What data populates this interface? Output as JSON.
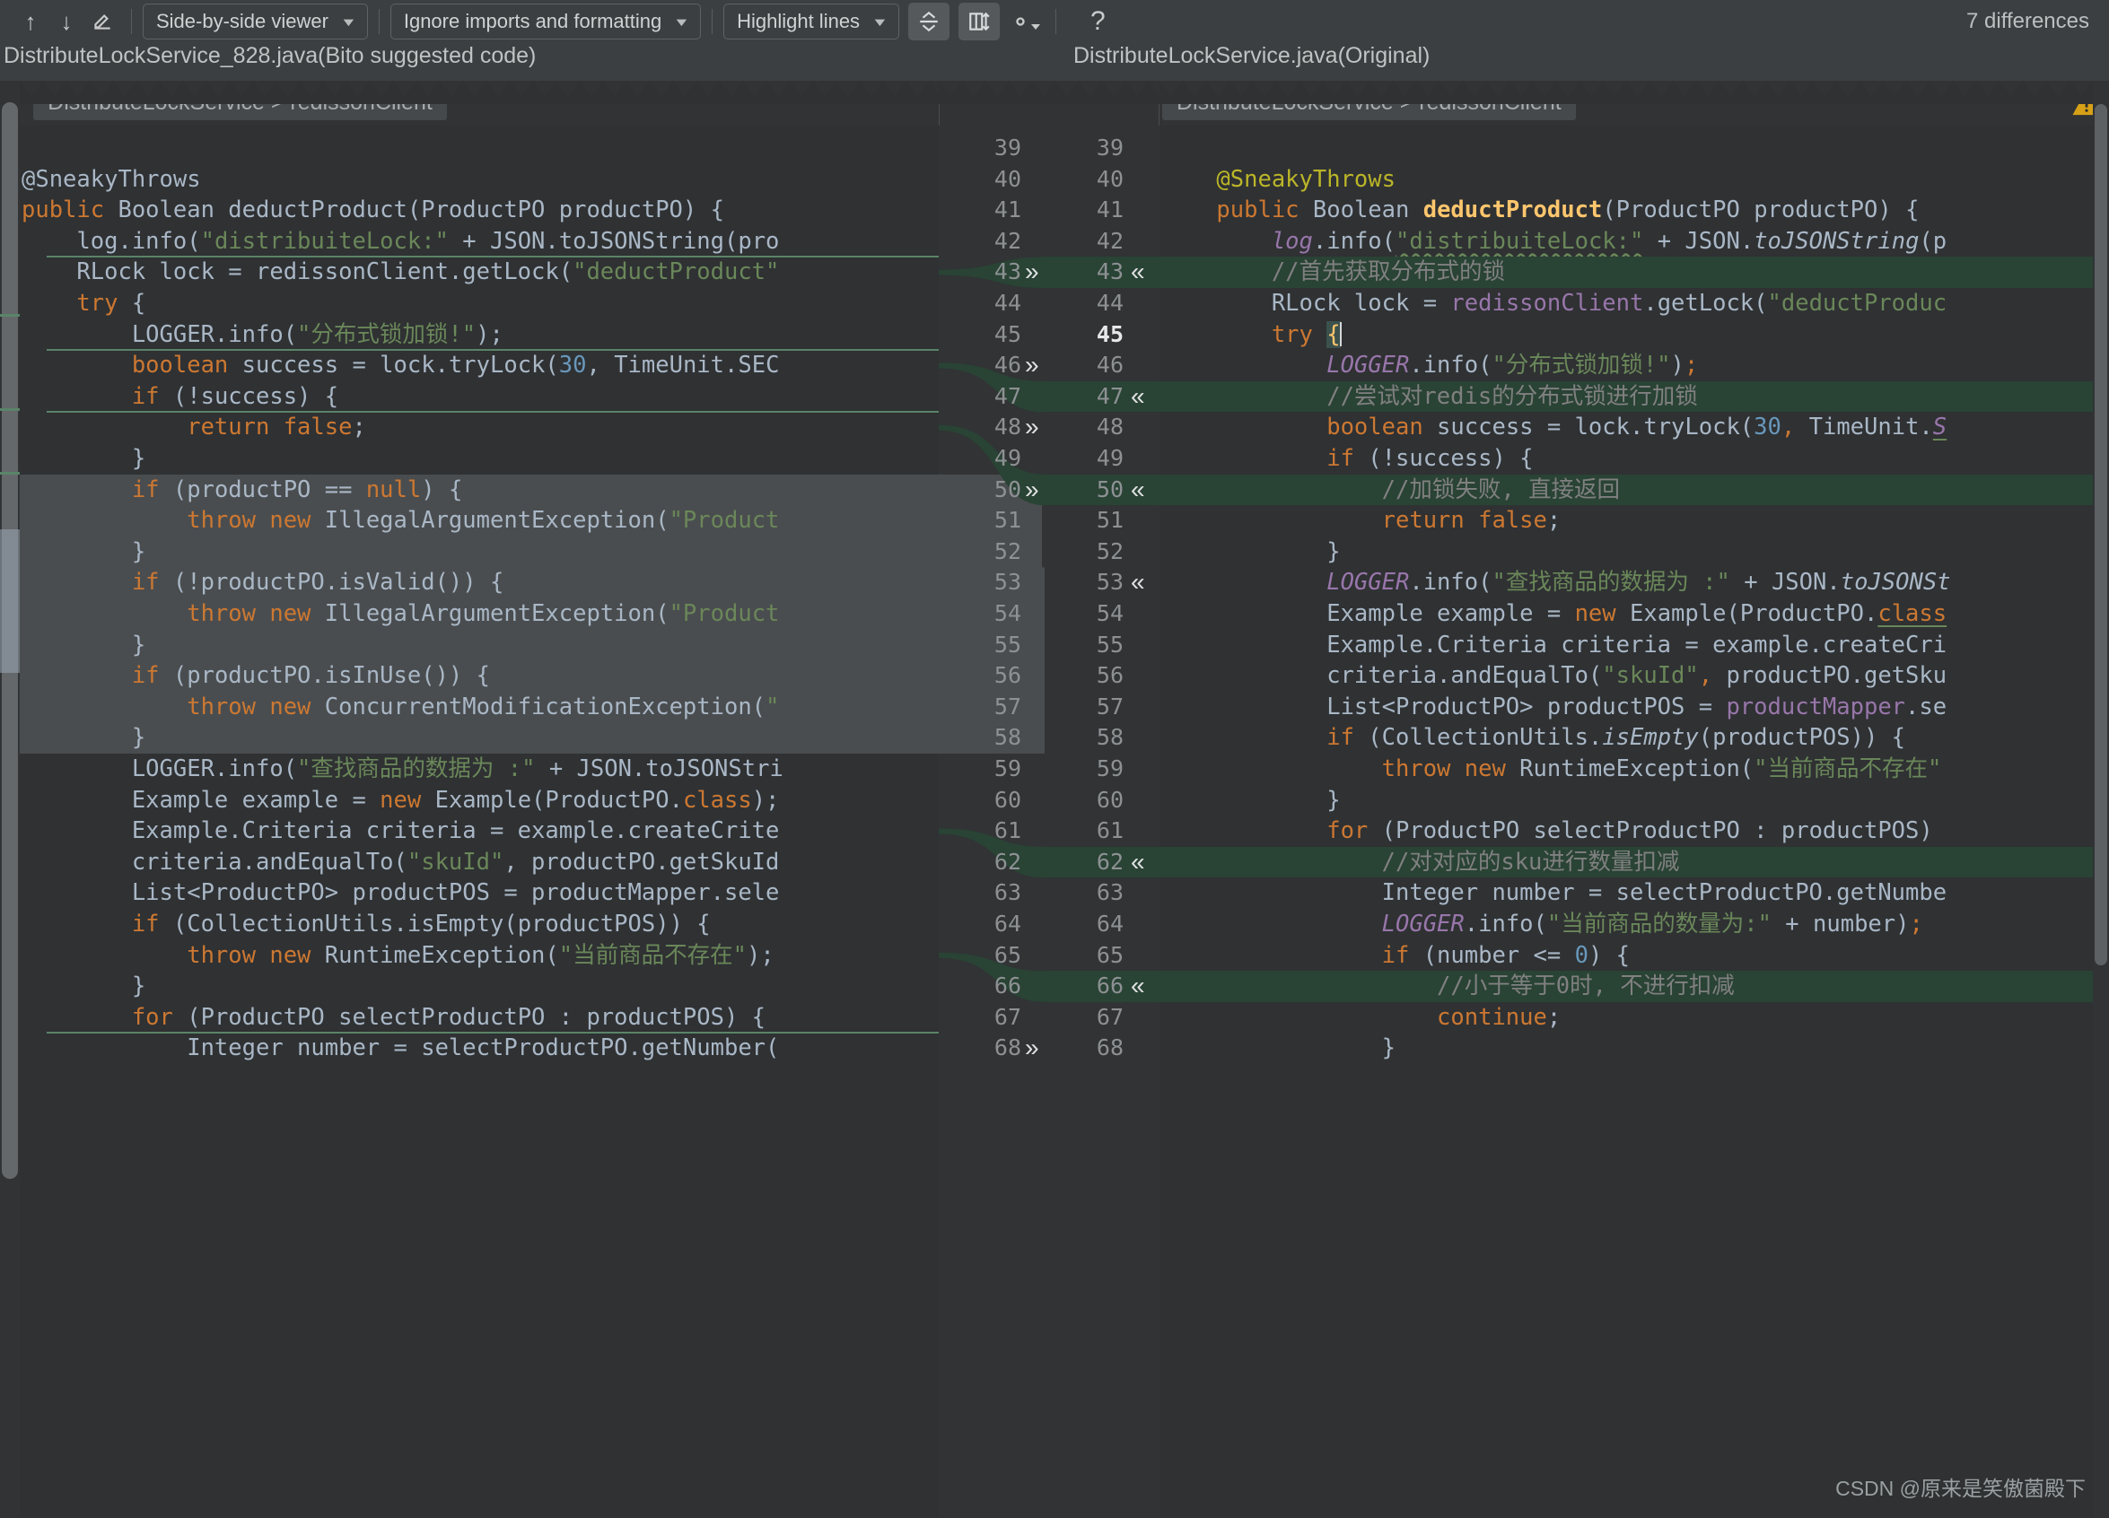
{
  "toolbar": {
    "prev_icon": "arrow-up-icon",
    "next_icon": "arrow-down-icon",
    "edit_icon": "pencil-icon",
    "viewer_mode": "Side-by-side viewer",
    "ignore_policy": "Ignore imports and formatting",
    "highlight_mode": "Highlight lines",
    "collapse_icon": "collapse-unchanged-icon",
    "whitespace_icon": "columns-sync-icon",
    "settings_icon": "gear-icon",
    "help_icon": "question-mark-icon",
    "difference_count": "7 differences",
    "caret": "▼"
  },
  "left_pane": {
    "file_title": "DistributeLockService_828.java(Bito suggested code)",
    "status_icon": "green-check-icon",
    "breadcrumb": "DistributeLockService > redissonClient"
  },
  "right_pane": {
    "file_title": "DistributeLockService.java(Original)",
    "breadcrumb": "DistributeLockService > redissonClient",
    "warning_icon": "warning-triangle-icon"
  },
  "colors": {
    "editor_bg": "#2f3133",
    "chrome_bg": "#3c3f41",
    "gutter_bg": "#313335",
    "diff_added_bg": "#294335",
    "diff_changed_bg": "#4a4d4f",
    "keyword": "#cc7832",
    "string": "#6a8759",
    "number": "#6897bb",
    "text": "#a9b7c6",
    "comment": "#808080",
    "field": "#9876aa",
    "method": "#ffc66d",
    "annotation": "#bbb529",
    "ok_green": "#499c54",
    "warn_yellow": "#d6a117"
  },
  "line_numbers": {
    "left": [
      39,
      40,
      41,
      42,
      43,
      44,
      45,
      46,
      47,
      48,
      49,
      50,
      51,
      52,
      53,
      54,
      55,
      56,
      57,
      58,
      59,
      60,
      61,
      62,
      63,
      64,
      65,
      66,
      67,
      68
    ],
    "right": [
      39,
      40,
      41,
      42,
      43,
      44,
      45,
      46,
      47,
      48,
      49,
      50,
      51,
      52,
      53,
      54,
      55,
      56,
      57,
      58,
      59,
      60,
      61,
      62,
      63,
      64,
      65,
      66,
      67,
      68
    ],
    "current_line": 45,
    "left_chevrons": [
      43,
      46,
      48,
      50,
      68
    ],
    "right_chevrons": [
      43,
      47,
      50,
      53,
      62,
      66
    ]
  },
  "left_code": [
    {
      "n": 39,
      "diff": "none",
      "tokens": []
    },
    {
      "n": 40,
      "diff": "none",
      "tokens": [
        {
          "t": "@SneakyThrows",
          "c": "txt"
        }
      ]
    },
    {
      "n": 41,
      "diff": "none",
      "tokens": [
        {
          "t": "public ",
          "c": "kw"
        },
        {
          "t": "Boolean deductProduct(ProductPO productPO) {",
          "c": "txt"
        }
      ]
    },
    {
      "n": 42,
      "diff": "none",
      "tokens": [
        {
          "t": "    log.info(",
          "c": "txt"
        },
        {
          "t": "\"distribuiteLock:\"",
          "c": "str"
        },
        {
          "t": " + JSON.toJSONString(pro",
          "c": "txt"
        }
      ]
    },
    {
      "n": 43,
      "diff": "delmark",
      "tokens": [
        {
          "t": "    RLock lock = redissonClient.getLock(",
          "c": "txt"
        },
        {
          "t": "\"deductProduct\"",
          "c": "str"
        }
      ]
    },
    {
      "n": 44,
      "diff": "none",
      "tokens": [
        {
          "t": "    try",
          "c": "kw"
        },
        {
          "t": " {",
          "c": "txt"
        }
      ]
    },
    {
      "n": 45,
      "diff": "none",
      "tokens": [
        {
          "t": "        LOGGER.info(",
          "c": "txt"
        },
        {
          "t": "\"分布式锁加锁!\"",
          "c": "str"
        },
        {
          "t": ");",
          "c": "txt"
        }
      ]
    },
    {
      "n": 46,
      "diff": "delmark",
      "tokens": [
        {
          "t": "        boolean",
          "c": "kw"
        },
        {
          "t": " success = lock.tryLock(",
          "c": "txt"
        },
        {
          "t": "30",
          "c": "num"
        },
        {
          "t": ", TimeUnit.SEC",
          "c": "txt"
        }
      ]
    },
    {
      "n": 47,
      "diff": "none",
      "tokens": [
        {
          "t": "        if",
          "c": "kw"
        },
        {
          "t": " (!success) {",
          "c": "txt"
        }
      ]
    },
    {
      "n": 48,
      "diff": "delmark",
      "tokens": [
        {
          "t": "            return false",
          "c": "kw"
        },
        {
          "t": ";",
          "c": "txt"
        }
      ]
    },
    {
      "n": 49,
      "diff": "none",
      "tokens": [
        {
          "t": "        }",
          "c": "txt"
        }
      ]
    },
    {
      "n": 50,
      "diff": "gray",
      "tokens": [
        {
          "t": "        if",
          "c": "kw"
        },
        {
          "t": " (productPO == ",
          "c": "txt"
        },
        {
          "t": "null",
          "c": "kw"
        },
        {
          "t": ") {",
          "c": "txt"
        }
      ]
    },
    {
      "n": 51,
      "diff": "gray",
      "tokens": [
        {
          "t": "            throw new",
          "c": "kw"
        },
        {
          "t": " IllegalArgumentException(",
          "c": "txt"
        },
        {
          "t": "\"Product",
          "c": "str"
        }
      ]
    },
    {
      "n": 52,
      "diff": "gray",
      "tokens": [
        {
          "t": "        }",
          "c": "txt"
        }
      ]
    },
    {
      "n": 53,
      "diff": "gray",
      "tokens": [
        {
          "t": "        if",
          "c": "kw"
        },
        {
          "t": " (!productPO.isValid()) {",
          "c": "txt"
        }
      ]
    },
    {
      "n": 54,
      "diff": "gray",
      "tokens": [
        {
          "t": "            throw new",
          "c": "kw"
        },
        {
          "t": " IllegalArgumentException(",
          "c": "txt"
        },
        {
          "t": "\"Product",
          "c": "str"
        }
      ]
    },
    {
      "n": 55,
      "diff": "gray",
      "tokens": [
        {
          "t": "        }",
          "c": "txt"
        }
      ]
    },
    {
      "n": 56,
      "diff": "gray",
      "tokens": [
        {
          "t": "        if",
          "c": "kw"
        },
        {
          "t": " (productPO.isInUse()) {",
          "c": "txt"
        }
      ]
    },
    {
      "n": 57,
      "diff": "gray",
      "tokens": [
        {
          "t": "            throw new",
          "c": "kw"
        },
        {
          "t": " ConcurrentModificationException(",
          "c": "txt"
        },
        {
          "t": "\"",
          "c": "str"
        }
      ]
    },
    {
      "n": 58,
      "diff": "gray",
      "tokens": [
        {
          "t": "        }",
          "c": "txt"
        }
      ]
    },
    {
      "n": 59,
      "diff": "none",
      "tokens": [
        {
          "t": "        LOGGER.info(",
          "c": "txt"
        },
        {
          "t": "\"查找商品的数据为 :\"",
          "c": "str"
        },
        {
          "t": " + JSON.toJSONStri",
          "c": "txt"
        }
      ]
    },
    {
      "n": 60,
      "diff": "none",
      "tokens": [
        {
          "t": "        Example example = ",
          "c": "txt"
        },
        {
          "t": "new",
          "c": "kw"
        },
        {
          "t": " Example(ProductPO.",
          "c": "txt"
        },
        {
          "t": "class",
          "c": "kw"
        },
        {
          "t": ");",
          "c": "txt"
        }
      ]
    },
    {
      "n": 61,
      "diff": "none",
      "tokens": [
        {
          "t": "        Example.Criteria criteria = example.createCrite",
          "c": "txt"
        }
      ]
    },
    {
      "n": 62,
      "diff": "none",
      "tokens": [
        {
          "t": "        criteria.andEqualTo(",
          "c": "txt"
        },
        {
          "t": "\"skuId\"",
          "c": "str"
        },
        {
          "t": ", productPO.getSkuId",
          "c": "txt"
        }
      ]
    },
    {
      "n": 63,
      "diff": "none",
      "tokens": [
        {
          "t": "        List<ProductPO> productPOS = productMapper.sele",
          "c": "txt"
        }
      ]
    },
    {
      "n": 64,
      "diff": "none",
      "tokens": [
        {
          "t": "        if",
          "c": "kw"
        },
        {
          "t": " (CollectionUtils.isEmpty(productPOS)) {",
          "c": "txt"
        }
      ]
    },
    {
      "n": 65,
      "diff": "none",
      "tokens": [
        {
          "t": "            throw new",
          "c": "kw"
        },
        {
          "t": " RuntimeException(",
          "c": "txt"
        },
        {
          "t": "\"当前商品不存在\"",
          "c": "str"
        },
        {
          "t": ");",
          "c": "txt"
        }
      ]
    },
    {
      "n": 66,
      "diff": "none",
      "tokens": [
        {
          "t": "        }",
          "c": "txt"
        }
      ]
    },
    {
      "n": 67,
      "diff": "none",
      "tokens": [
        {
          "t": "        for",
          "c": "kw"
        },
        {
          "t": " (ProductPO selectProductPO : productPOS) {",
          "c": "txt"
        }
      ]
    },
    {
      "n": 68,
      "diff": "delmark",
      "tokens": [
        {
          "t": "            Integer number = selectProductPO.getNumber(",
          "c": "txt"
        }
      ]
    }
  ],
  "right_code": [
    {
      "n": 39,
      "diff": "none",
      "tokens": []
    },
    {
      "n": 40,
      "diff": "none",
      "tokens": [
        {
          "t": "    @SneakyThrows",
          "c": "ann"
        }
      ]
    },
    {
      "n": 41,
      "diff": "none",
      "tokens": [
        {
          "t": "    public ",
          "c": "kw"
        },
        {
          "t": "Boolean ",
          "c": "txt"
        },
        {
          "t": "deductProduct",
          "c": "mthb"
        },
        {
          "t": "(ProductPO productPO) {",
          "c": "txt"
        }
      ]
    },
    {
      "n": 42,
      "diff": "none",
      "tokens": [
        {
          "t": "        log",
          "c": "fldi"
        },
        {
          "t": ".info(",
          "c": "txt"
        },
        {
          "t": "\"distribuiteLock:\"",
          "c": "str squig"
        },
        {
          "t": " + JSON.",
          "c": "txt"
        },
        {
          "t": "toJSONString",
          "c": "mthi"
        },
        {
          "t": "(p",
          "c": "txt"
        }
      ]
    },
    {
      "n": 43,
      "diff": "green",
      "tokens": [
        {
          "t": "        //首先获取分布式的锁",
          "c": "cmt"
        }
      ]
    },
    {
      "n": 44,
      "diff": "none",
      "tokens": [
        {
          "t": "        RLock lock = ",
          "c": "txt"
        },
        {
          "t": "redissonClient",
          "c": "fld"
        },
        {
          "t": ".getLock(",
          "c": "txt"
        },
        {
          "t": "\"deductProduc",
          "c": "str"
        }
      ]
    },
    {
      "n": 45,
      "diff": "none",
      "tokens": [
        {
          "t": "        try ",
          "c": "kw"
        },
        {
          "t": "{",
          "c": "brace"
        },
        {
          "t": "|caret|",
          "c": "caret"
        }
      ]
    },
    {
      "n": 46,
      "diff": "none",
      "tokens": [
        {
          "t": "            LOGGER",
          "c": "fldi"
        },
        {
          "t": ".info(",
          "c": "txt"
        },
        {
          "t": "\"分布式锁加锁!\"",
          "c": "str"
        },
        {
          "t": ")",
          "c": "txt"
        },
        {
          "t": ";",
          "c": "kw"
        }
      ]
    },
    {
      "n": 47,
      "diff": "green",
      "tokens": [
        {
          "t": "            //尝试对redis的分布式锁进行加锁",
          "c": "cmt"
        }
      ]
    },
    {
      "n": 48,
      "diff": "none",
      "tokens": [
        {
          "t": "            boolean",
          "c": "kw"
        },
        {
          "t": " success = lock.tryLock(",
          "c": "txt"
        },
        {
          "t": "30",
          "c": "num"
        },
        {
          "t": ", ",
          "c": "kw"
        },
        {
          "t": "TimeUnit.",
          "c": "txt"
        },
        {
          "t": "S",
          "c": "fldi uline"
        }
      ]
    },
    {
      "n": 49,
      "diff": "none",
      "tokens": [
        {
          "t": "            if",
          "c": "kw"
        },
        {
          "t": " (!success) {",
          "c": "txt"
        }
      ]
    },
    {
      "n": 50,
      "diff": "green",
      "tokens": [
        {
          "t": "                //加锁失败, 直接返回",
          "c": "cmt"
        }
      ]
    },
    {
      "n": 51,
      "diff": "none",
      "tokens": [
        {
          "t": "                return false",
          "c": "kw"
        },
        {
          "t": ";",
          "c": "txt"
        }
      ]
    },
    {
      "n": 52,
      "diff": "none",
      "tokens": [
        {
          "t": "            }",
          "c": "txt"
        }
      ]
    },
    {
      "n": 53,
      "diff": "none",
      "tokens": [
        {
          "t": "            LOGGER",
          "c": "fldi"
        },
        {
          "t": ".info(",
          "c": "txt"
        },
        {
          "t": "\"查找商品的数据为 :\"",
          "c": "str"
        },
        {
          "t": " + JSON.",
          "c": "txt"
        },
        {
          "t": "toJSONSt",
          "c": "mthi"
        }
      ]
    },
    {
      "n": 54,
      "diff": "none",
      "tokens": [
        {
          "t": "            Example example = ",
          "c": "txt"
        },
        {
          "t": "new",
          "c": "kw"
        },
        {
          "t": " Example(ProductPO.",
          "c": "txt"
        },
        {
          "t": "class",
          "c": "kw uline"
        }
      ]
    },
    {
      "n": 55,
      "diff": "none",
      "tokens": [
        {
          "t": "            Example.Criteria criteria = example.createCri",
          "c": "txt"
        }
      ]
    },
    {
      "n": 56,
      "diff": "none",
      "tokens": [
        {
          "t": "            criteria.andEqualTo(",
          "c": "txt"
        },
        {
          "t": "\"skuId\"",
          "c": "str"
        },
        {
          "t": ",",
          "c": "kw"
        },
        {
          "t": " productPO.getSku",
          "c": "txt"
        }
      ]
    },
    {
      "n": 57,
      "diff": "none",
      "tokens": [
        {
          "t": "            List<ProductPO> productPOS = ",
          "c": "txt"
        },
        {
          "t": "productMapper",
          "c": "fld"
        },
        {
          "t": ".se",
          "c": "txt"
        }
      ]
    },
    {
      "n": 58,
      "diff": "none",
      "tokens": [
        {
          "t": "            if",
          "c": "kw"
        },
        {
          "t": " (CollectionUtils.",
          "c": "txt"
        },
        {
          "t": "isEmpty",
          "c": "mthi"
        },
        {
          "t": "(productPOS)) {",
          "c": "txt"
        }
      ]
    },
    {
      "n": 59,
      "diff": "none",
      "tokens": [
        {
          "t": "                throw new",
          "c": "kw"
        },
        {
          "t": " RuntimeException(",
          "c": "txt"
        },
        {
          "t": "\"当前商品不存在\"",
          "c": "str"
        }
      ]
    },
    {
      "n": 60,
      "diff": "none",
      "tokens": [
        {
          "t": "            }",
          "c": "txt"
        }
      ]
    },
    {
      "n": 61,
      "diff": "none",
      "tokens": [
        {
          "t": "            for",
          "c": "kw"
        },
        {
          "t": " (ProductPO selectProductPO : productPOS)",
          "c": "txt"
        }
      ]
    },
    {
      "n": 62,
      "diff": "green",
      "tokens": [
        {
          "t": "                //对对应的sku进行数量扣减",
          "c": "cmt"
        }
      ]
    },
    {
      "n": 63,
      "diff": "none",
      "tokens": [
        {
          "t": "                Integer number = selectProductPO.getNumbe",
          "c": "txt"
        }
      ]
    },
    {
      "n": 64,
      "diff": "none",
      "tokens": [
        {
          "t": "                LOGGER",
          "c": "fldi"
        },
        {
          "t": ".info(",
          "c": "txt"
        },
        {
          "t": "\"当前商品的数量为:\"",
          "c": "str"
        },
        {
          "t": " + number)",
          "c": "txt"
        },
        {
          "t": ";",
          "c": "kw"
        }
      ]
    },
    {
      "n": 65,
      "diff": "none",
      "tokens": [
        {
          "t": "                if",
          "c": "kw"
        },
        {
          "t": " (number <= ",
          "c": "txt"
        },
        {
          "t": "0",
          "c": "num"
        },
        {
          "t": ") {",
          "c": "txt"
        }
      ]
    },
    {
      "n": 66,
      "diff": "green",
      "tokens": [
        {
          "t": "                    //小于等于0时, 不进行扣减",
          "c": "cmt"
        }
      ]
    },
    {
      "n": 67,
      "diff": "none",
      "tokens": [
        {
          "t": "                    continue",
          "c": "kw"
        },
        {
          "t": ";",
          "c": "txt"
        }
      ]
    },
    {
      "n": 68,
      "diff": "none",
      "tokens": [
        {
          "t": "                }",
          "c": "txt"
        }
      ]
    }
  ],
  "watermark": "CSDN @原来是笑傲菌殿下"
}
